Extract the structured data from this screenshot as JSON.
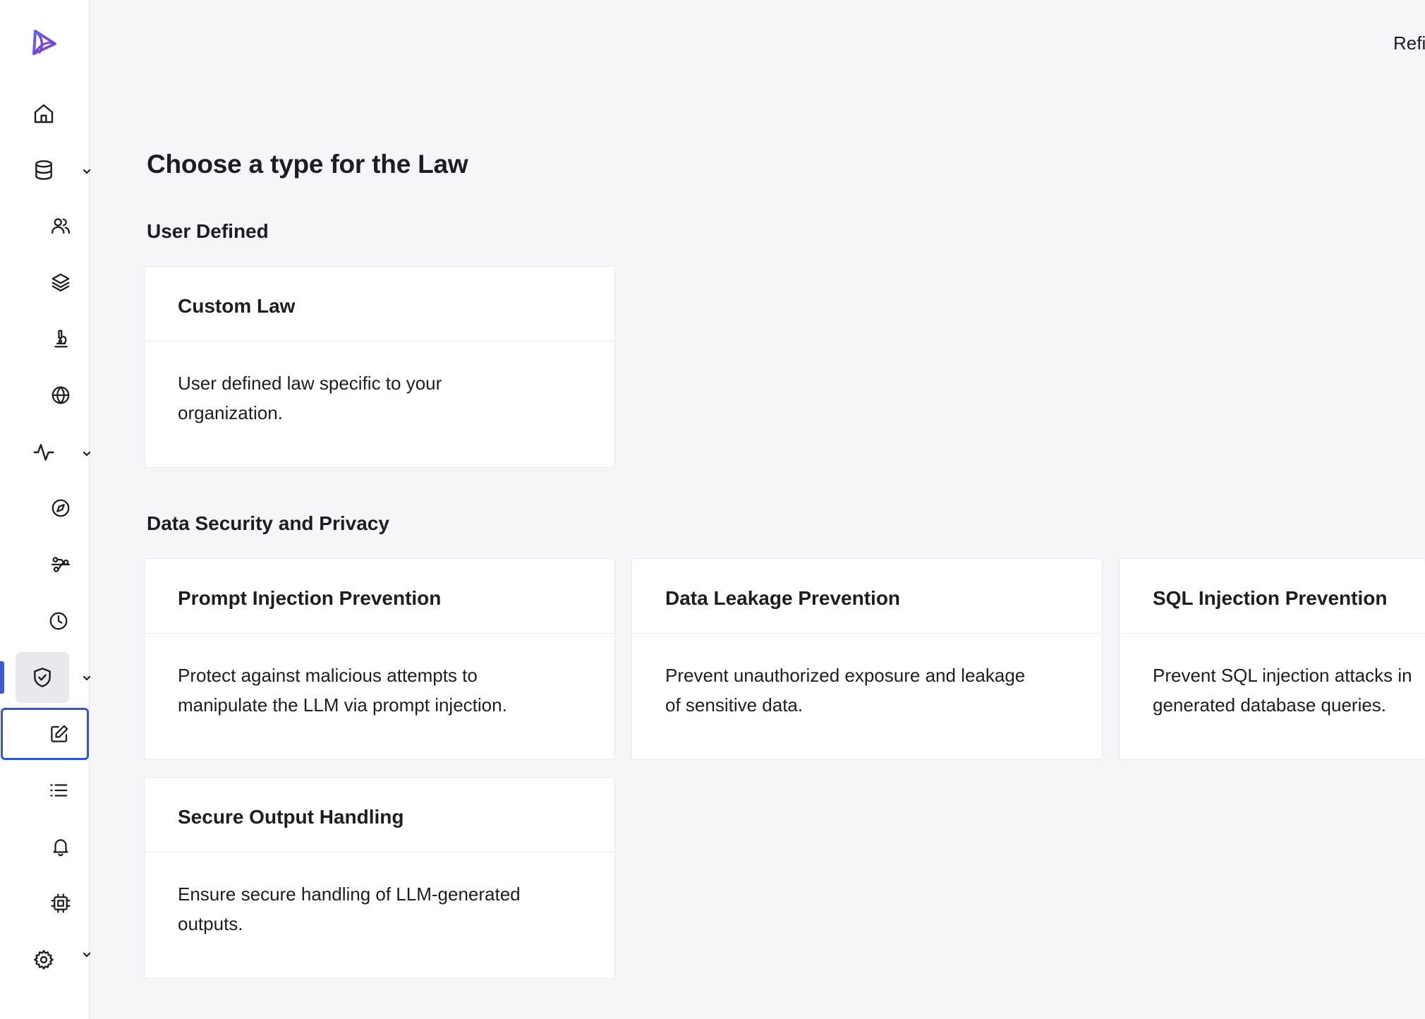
{
  "header": {
    "top_action_label": "Refi"
  },
  "page": {
    "title": "Choose a type for the Law"
  },
  "sections": [
    {
      "title": "User Defined",
      "cards": [
        {
          "title": "Custom Law",
          "lines": [
            "User defined law specific to your",
            "organization."
          ]
        }
      ]
    },
    {
      "title": "Data Security and Privacy",
      "cards": [
        {
          "title": "Prompt Injection Prevention",
          "lines": [
            "Protect against malicious attempts to",
            "manipulate the LLM via prompt injection."
          ]
        },
        {
          "title": "Data Leakage Prevention",
          "lines": [
            "Prevent unauthorized exposure and leakage",
            "of sensitive data."
          ]
        },
        {
          "title": "SQL Injection Prevention",
          "lines": [
            "Prevent SQL injection attacks in",
            "generated database queries."
          ]
        },
        {
          "title": "Secure Output Handling",
          "lines": [
            "Ensure secure handling of LLM-generated",
            "outputs."
          ]
        }
      ]
    }
  ],
  "sidebar": {
    "icons": [
      "logo-icon",
      "home-icon",
      "database-icon",
      "users-icon",
      "layers-icon",
      "microscope-icon",
      "globe-icon",
      "activity-icon",
      "compass-icon",
      "workflow-icon",
      "clock-icon",
      "shield-check-icon",
      "edit-icon",
      "list-icon",
      "bell-icon",
      "cpu-icon",
      "settings-icon"
    ],
    "active_item": "shield-check-icon",
    "accent_color": "#3b5bdb"
  }
}
